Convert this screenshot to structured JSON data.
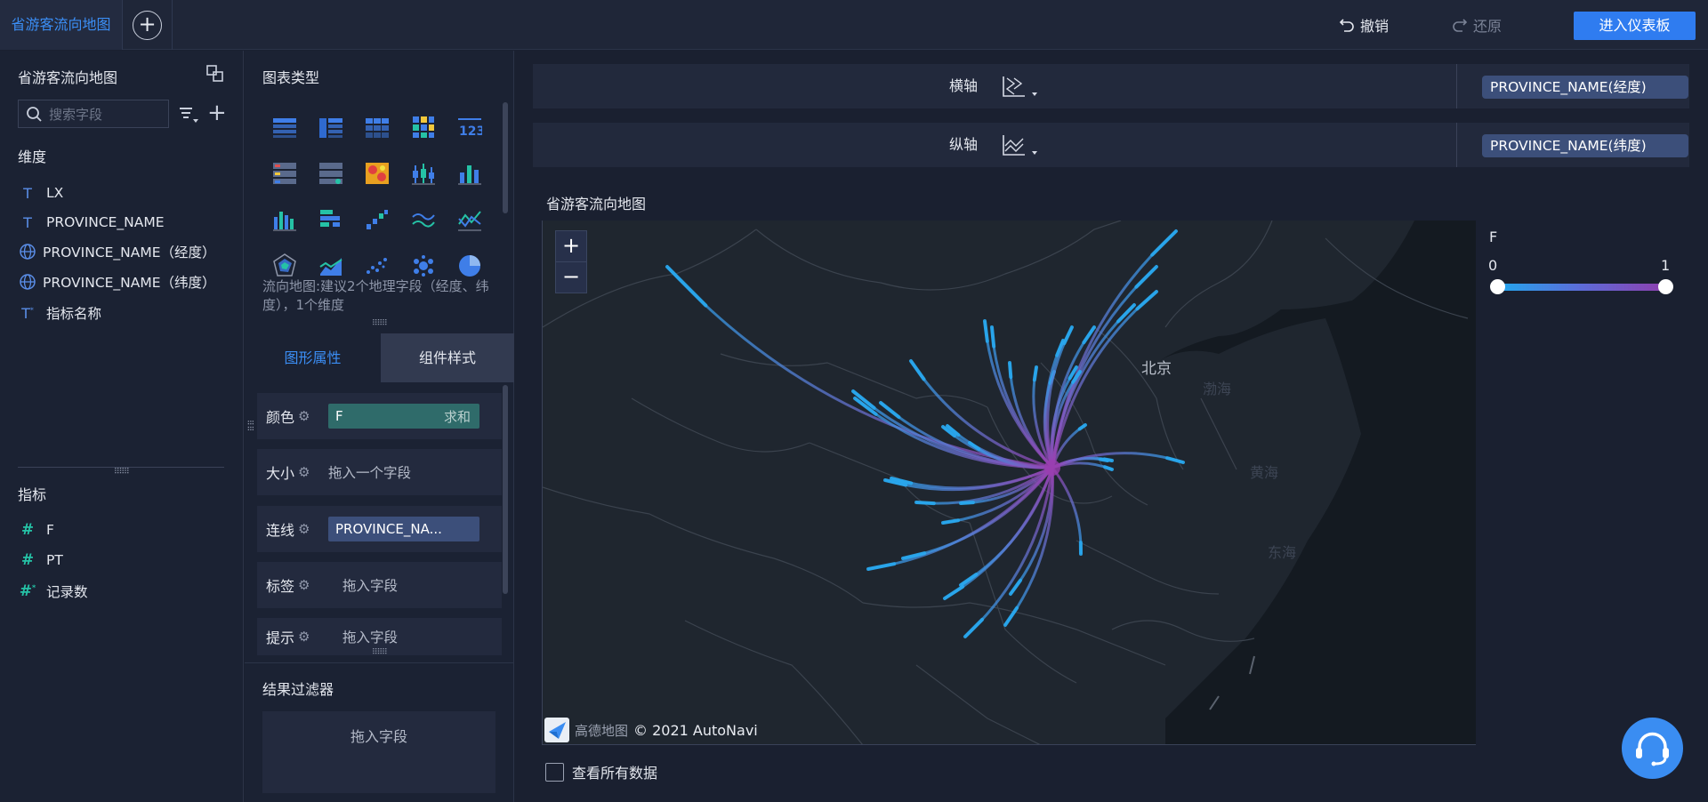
{
  "header": {
    "active_tab": "省游客流向地图",
    "undo_label": "撤销",
    "redo_label": "还原",
    "enter_dashboard_label": "进入仪表板"
  },
  "fields_panel": {
    "title": "省游客流向地图",
    "search_placeholder": "搜索字段",
    "dimensions_label": "维度",
    "dimensions": [
      {
        "label": "LX",
        "icon": "text-type-icon"
      },
      {
        "label": "PROVINCE_NAME",
        "icon": "text-type-icon"
      },
      {
        "label": "PROVINCE_NAME（经度）",
        "icon": "globe-icon"
      },
      {
        "label": "PROVINCE_NAME（纬度）",
        "icon": "globe-icon"
      },
      {
        "label": "指标名称",
        "icon": "text-type-icon"
      }
    ],
    "measures_label": "指标",
    "measures": [
      {
        "label": "F",
        "icon": "number-type-icon"
      },
      {
        "label": "PT",
        "icon": "number-type-icon"
      },
      {
        "label": "记录数",
        "icon": "number-type-icon"
      }
    ]
  },
  "config_panel": {
    "chart_types_label": "图表类型",
    "chart_type_hint": "流向地图:建议2个地理字段（经度、纬度），1个维度",
    "tabs": [
      "图形属性",
      "组件样式"
    ],
    "properties": [
      {
        "label": "颜色",
        "value": "F",
        "aggregation": "求和"
      },
      {
        "label": "大小",
        "value": "拖入一个字段"
      },
      {
        "label": "连线",
        "value": "PROVINCE_NA..."
      },
      {
        "label": "标签",
        "value": "拖入字段"
      },
      {
        "label": "提示",
        "value": "拖入字段"
      }
    ],
    "result_filter_label": "结果过滤器",
    "result_filter_drop": "拖入字段"
  },
  "axes": {
    "x": {
      "label": "横轴",
      "field": "PROVINCE_NAME(经度)"
    },
    "y": {
      "label": "纵轴",
      "field": "PROVINCE_NAME(纬度)"
    }
  },
  "chart": {
    "title": "省游客流向地图",
    "zoom_in": "+",
    "zoom_out": "−",
    "map_labels": {
      "beijing": "北京",
      "bohai": "渤海",
      "yellow_sea": "黄海",
      "east_sea": "东海"
    },
    "attribution_brand": "高德地图",
    "attribution": "© 2021 AutoNavi",
    "legend": {
      "title": "F",
      "min": "0",
      "max": "1",
      "colors": [
        "#22a7ee",
        "#8e3fae"
      ]
    },
    "show_all_label": "查看所有数据"
  },
  "colors": {
    "accent": "#2f7cf0",
    "active_tab": "#3b8ef5",
    "flow_start": "#29a8f0",
    "flow_end": "#9a3fb0"
  }
}
